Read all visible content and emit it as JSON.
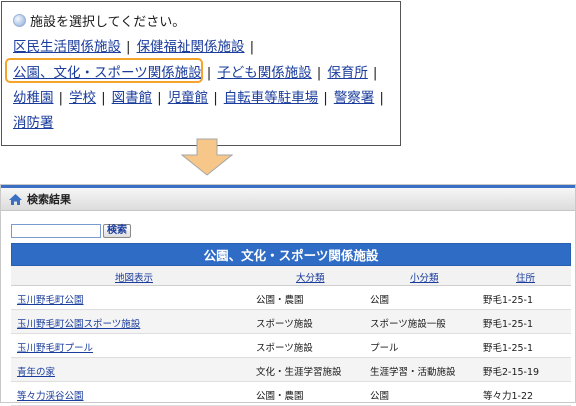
{
  "prompt": "施設を選択してください。",
  "categories": [
    [
      "区民生活関係施設",
      "保健福祉関係施設"
    ],
    [
      "公園、文化・スポーツ関係施設",
      "子ども関係施設",
      "保育所"
    ],
    [
      "幼稚園",
      "学校",
      "図書館",
      "児童館",
      "自転車等駐車場",
      "警察署"
    ],
    [
      "消防署"
    ]
  ],
  "separator": "|",
  "highlight_color": "#f4a32b",
  "results": {
    "window_title": "検索結果",
    "search_placeholder": "",
    "search_button": "検索",
    "table_title": "公園、文化・スポーツ関係施設",
    "columns": [
      "地図表示",
      "大分類",
      "小分類",
      "住所"
    ],
    "rows": [
      {
        "name": "玉川野毛町公園",
        "category": "公園・農園",
        "subcategory": "公園",
        "address": "野毛1-25-1"
      },
      {
        "name": "玉川野毛町公園スポーツ施設",
        "category": "スポーツ施設",
        "subcategory": "スポーツ施設一般",
        "address": "野毛1-25-1"
      },
      {
        "name": "玉川野毛町プール",
        "category": "スポーツ施設",
        "subcategory": "プール",
        "address": "野毛1-25-1"
      },
      {
        "name": "青年の家",
        "category": "文化・生涯学習施設",
        "subcategory": "生涯学習・活動施設",
        "address": "野毛2-15-19"
      },
      {
        "name": "等々力渓谷公園",
        "category": "公園・農園",
        "subcategory": "公園",
        "address": "等々力1-22"
      }
    ]
  },
  "colors": {
    "link": "#1a3c9c",
    "table_header_bg": "#2f6cc6",
    "arrow_fill": "#f7c78a"
  }
}
